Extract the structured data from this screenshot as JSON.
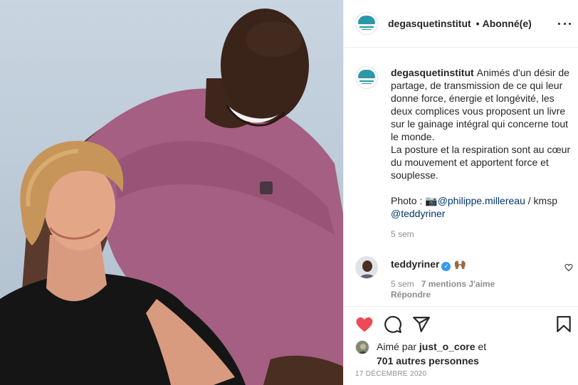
{
  "header": {
    "username": "degasquetinstitut",
    "separator": "•",
    "follow_state": "Abonné(e)",
    "more_icon": "more-horizontal-icon"
  },
  "caption": {
    "username": "degasquetinstitut",
    "text": "Animés d'un désir de partage, de transmission de ce qui leur donne force, énergie et longévité, les deux complices vous proposent un livre sur le gainage intégral qui concerne tout le monde.\nLa posture et la respiration sont au cœur du mouvement et apportent force et souplesse.",
    "photo_credit_prefix": "Photo : 📷",
    "photo_credit_handle": "@philippe.millereau",
    "photo_credit_suffix": " / kmsp",
    "tag_handle": "@teddyriner",
    "time": "5 sem"
  },
  "reply": {
    "username": "teddyriner",
    "verified_icon": "verified-badge-icon",
    "emoji": "🙌🏾",
    "time": "5 sem",
    "likes_label": "7 mentions J'aime",
    "reply_label": "Répondre"
  },
  "actions": {
    "like_icon": "heart-filled-icon",
    "comment_icon": "comment-icon",
    "share_icon": "share-icon",
    "save_icon": "bookmark-icon",
    "like_color": "#ed4956"
  },
  "likes": {
    "prefix": "Aimé par ",
    "user": "just_o_core",
    "middle": " et",
    "others": "701 autres personnes"
  },
  "date": "17 DÉCEMBRE 2020",
  "colors": {
    "text": "#262626",
    "secondary": "#8e8e8e",
    "link": "#00376b",
    "brand": "#2b97a7",
    "verified": "#3897f0"
  }
}
